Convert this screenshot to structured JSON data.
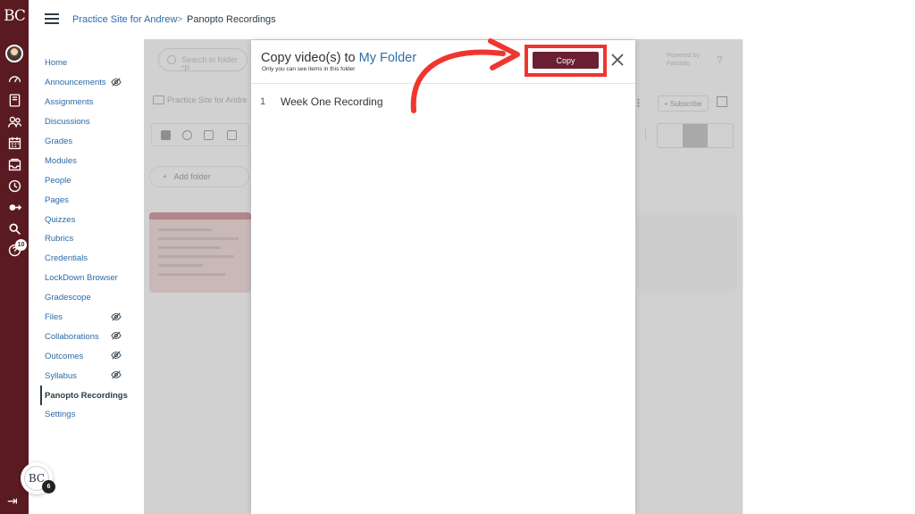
{
  "brand": {
    "logo_text": "BC"
  },
  "rail": {
    "items": [
      "account-icon",
      "dashboard-icon",
      "courses-icon",
      "groups-icon",
      "calendar-icon",
      "inbox-icon",
      "history-icon",
      "logout-icon",
      "search-icon",
      "help-icon"
    ],
    "help_badge": "10"
  },
  "breadcrumb": {
    "course": "Practice Site for Andrew",
    "separator": ">",
    "page": "Panopto Recordings"
  },
  "course_nav": {
    "items": [
      {
        "label": "Home",
        "hidden": false
      },
      {
        "label": "Announcements",
        "hidden": true
      },
      {
        "label": "Assignments",
        "hidden": false
      },
      {
        "label": "Discussions",
        "hidden": false
      },
      {
        "label": "Grades",
        "hidden": false
      },
      {
        "label": "Modules",
        "hidden": false
      },
      {
        "label": "People",
        "hidden": false
      },
      {
        "label": "Pages",
        "hidden": false
      },
      {
        "label": "Quizzes",
        "hidden": false
      },
      {
        "label": "Rubrics",
        "hidden": false
      },
      {
        "label": "Credentials",
        "hidden": false
      },
      {
        "label": "LockDown Browser",
        "hidden": false
      },
      {
        "label": "Gradescope",
        "hidden": false
      },
      {
        "label": "Files",
        "hidden": true
      },
      {
        "label": "Collaborations",
        "hidden": true
      },
      {
        "label": "Outcomes",
        "hidden": true
      },
      {
        "label": "Syllabus",
        "hidden": true
      },
      {
        "label": "Panopto Recordings",
        "hidden": false,
        "active": true
      },
      {
        "label": "Settings",
        "hidden": false
      }
    ]
  },
  "panopto": {
    "search_placeholder": "Search in folder \"P",
    "folder_path": "Practice Site for Andre",
    "add_folder": "Add folder",
    "powered_by": "Powered by Panopto",
    "help": "?",
    "subscribe": "Subscribe"
  },
  "modal": {
    "title_prefix": "Copy video(s) to",
    "folder_name": "My Folder",
    "subtitle": "Only you can see items in this folder",
    "copy_label": "Copy",
    "items": [
      {
        "index": "1",
        "name": "Week One Recording"
      }
    ]
  },
  "user": {
    "initials": "BC",
    "notification_count": "6"
  },
  "colors": {
    "rail": "#5a1a22",
    "copy_button": "#6b1f33",
    "highlight": "#f0352f",
    "link": "#2b6aa8",
    "folder_link": "#2e6fa8"
  }
}
